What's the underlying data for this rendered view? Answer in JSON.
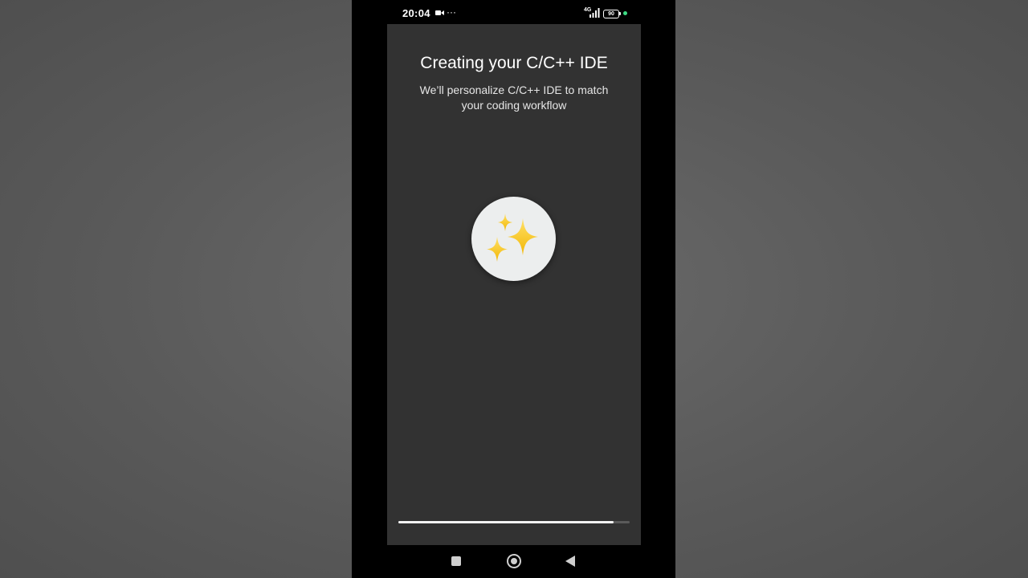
{
  "status_bar": {
    "time": "20:04",
    "overflow": "···",
    "network": "4G",
    "battery": "90",
    "recording_icon": "video-camera-icon",
    "signal_icon": "signal-bars-icon",
    "dot_color": "#3ddc84"
  },
  "screen": {
    "title": "Creating your C/C++ IDE",
    "subtitle": "We’ll personalize C/C++ IDE to match your coding workflow",
    "icon": "sparkles-icon",
    "progress_percent": 93
  },
  "nav_bar": {
    "recents_icon": "square-recents-icon",
    "home_icon": "circle-home-icon",
    "back_icon": "triangle-back-icon"
  },
  "colors": {
    "screen_background": "#323232",
    "sparkle": "#f7c928"
  }
}
